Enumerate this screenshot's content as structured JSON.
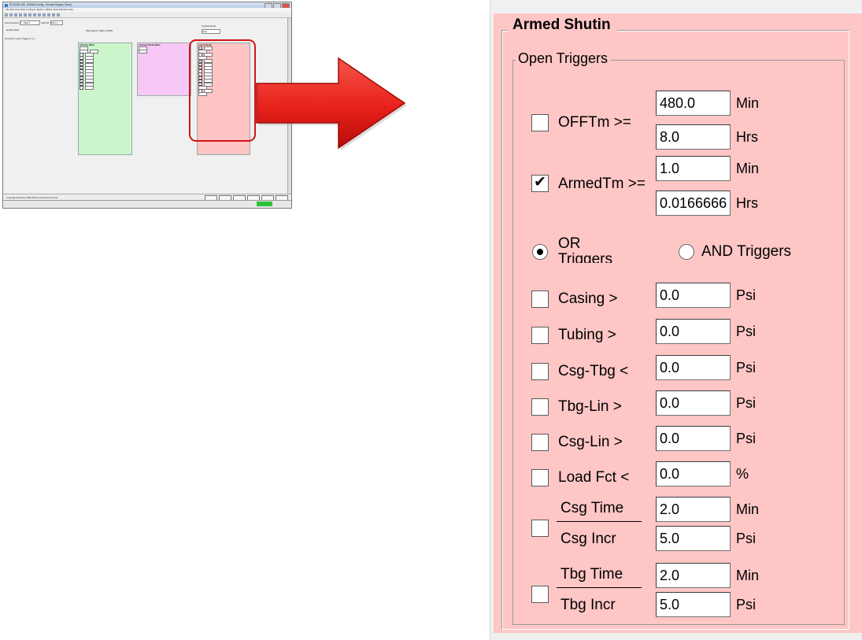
{
  "thumbnail": {
    "window_title": "ROCDNK B/E - [PM&M Config - Remote Display Client]",
    "menu": "File  Edit  View  Web  Configure  Master  Utilities  Tools  Window  Help",
    "field_number_label": "Field Number",
    "field_number_value": "1 - Well 1",
    "wellid_label": "Well ID:",
    "wellid_value": "Well 1",
    "enable_label": "Enable Well",
    "well_status": "Well Status:   WELL OPEN",
    "cycle_mode_label": "Cycling Mode",
    "cycle_mode_value": "Auto",
    "tabs": "General  |  Cycle Triggers  |  |  |  |",
    "afterflow_title": "Afterflow (Max)",
    "unarmed_title": "Unarmed Shutin (Max)",
    "armed_title": "Armed Shutin",
    "footer_text": "Copyright Protected 1996-2016 by Emerson Process",
    "footer_buttons": [
      "Print",
      "Save As",
      "Help Guide",
      "Update",
      "Close",
      "Apply"
    ]
  },
  "arrow": {
    "color": "#e8201a"
  },
  "armed_shutin": {
    "title": "Armed Shutin",
    "background": "#ffc6c6",
    "open_triggers_title": "Open Triggers",
    "offtm": {
      "label": "OFFTm >=",
      "checked": false,
      "min_value": "480.0",
      "min_unit": "Min",
      "hrs_value": "8.0",
      "hrs_unit": "Hrs"
    },
    "armedtm": {
      "label": "ArmedTm >=",
      "checked": true,
      "min_value": "1.0",
      "min_unit": "Min",
      "hrs_value": "0.0166666",
      "hrs_unit": "Hrs"
    },
    "or_triggers": {
      "label": "OR Triggers",
      "selected": true
    },
    "and_triggers": {
      "label": "AND Triggers",
      "selected": false
    },
    "triggers": [
      {
        "label": "Casing >",
        "value": "0.0",
        "unit": "Psi",
        "checked": false
      },
      {
        "label": "Tubing >",
        "value": "0.0",
        "unit": "Psi",
        "checked": false
      },
      {
        "label": "Csg-Tbg <",
        "value": "0.0",
        "unit": "Psi",
        "checked": false
      },
      {
        "label": "Tbg-Lin >",
        "value": "0.0",
        "unit": "Psi",
        "checked": false
      },
      {
        "label": "Csg-Lin >",
        "value": "0.0",
        "unit": "Psi",
        "checked": false
      },
      {
        "label": "Load Fct <",
        "value": "0.0",
        "unit": "%",
        "checked": false
      }
    ],
    "csg_rate": {
      "checked": false,
      "time_label": "Csg Time",
      "time_value": "2.0",
      "time_unit": "Min",
      "incr_label": "Csg Incr",
      "incr_value": "5.0",
      "incr_unit": "Psi"
    },
    "tbg_rate": {
      "checked": false,
      "time_label": "Tbg Time",
      "time_value": "2.0",
      "time_unit": "Min",
      "incr_label": "Tbg Incr",
      "incr_value": "5.0",
      "incr_unit": "Psi"
    }
  }
}
